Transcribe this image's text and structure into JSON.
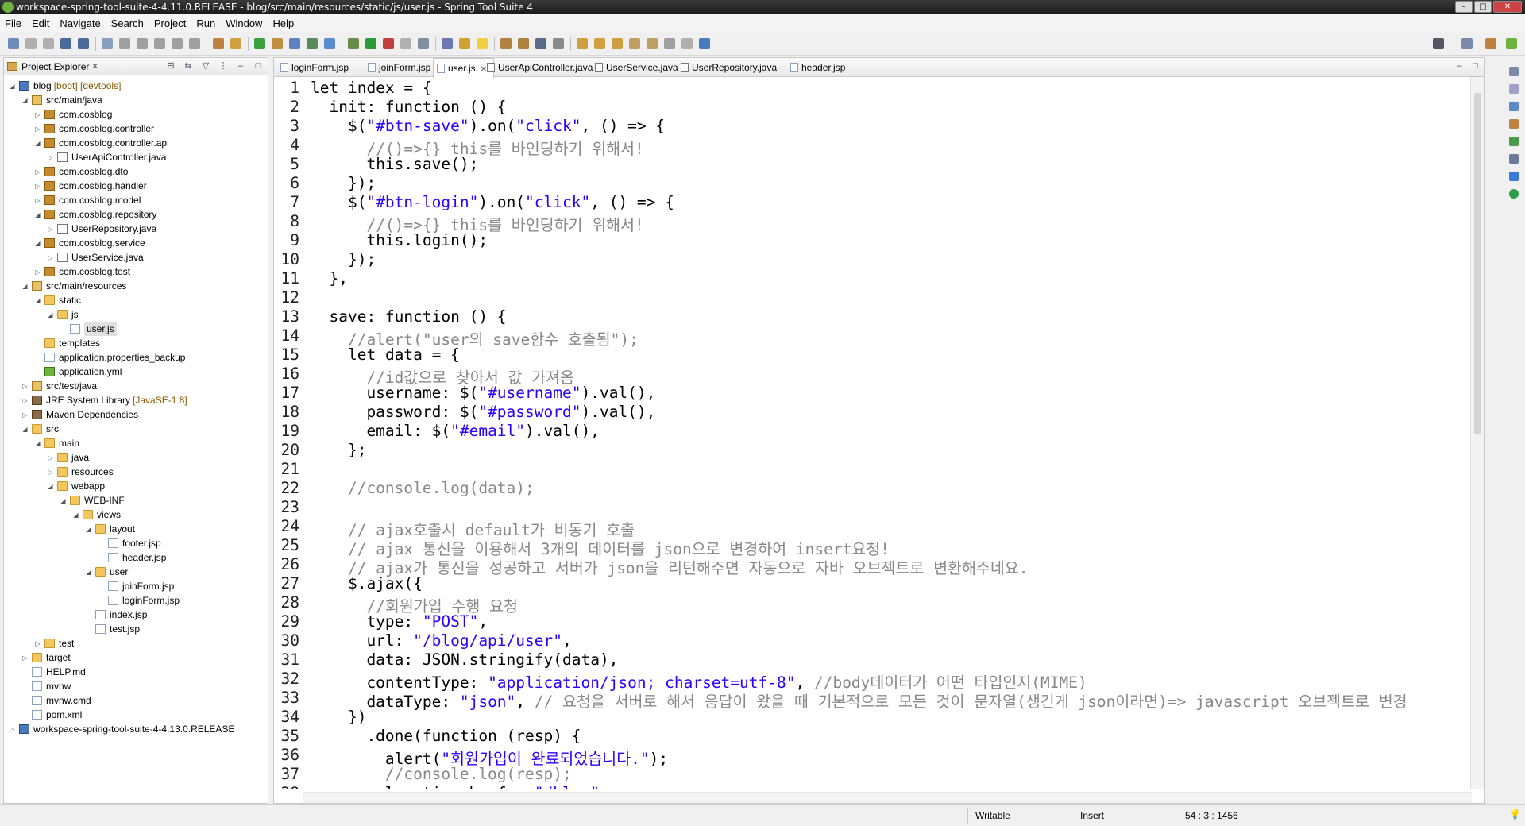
{
  "window": {
    "title": "workspace-spring-tool-suite-4-4.11.0.RELEASE - blog/src/main/resources/static/js/user.js - Spring Tool Suite 4"
  },
  "menu": [
    "File",
    "Edit",
    "Navigate",
    "Search",
    "Project",
    "Run",
    "Window",
    "Help"
  ],
  "explorer": {
    "title": "Project Explorer",
    "tree": [
      {
        "label": "blog",
        "extra": "[boot] [devtools]",
        "icon": "project",
        "depth": 0,
        "tw": "open"
      },
      {
        "label": "src/main/java",
        "icon": "source-folder",
        "depth": 1,
        "tw": "open"
      },
      {
        "label": "com.cosblog",
        "icon": "package",
        "depth": 2,
        "tw": "closed"
      },
      {
        "label": "com.cosblog.controller",
        "icon": "package",
        "depth": 2,
        "tw": "closed"
      },
      {
        "label": "com.cosblog.controller.api",
        "icon": "package",
        "depth": 2,
        "tw": "open"
      },
      {
        "label": "UserApiController.java",
        "icon": "java",
        "depth": 3,
        "tw": "closed"
      },
      {
        "label": "com.cosblog.dto",
        "icon": "package",
        "depth": 2,
        "tw": "closed"
      },
      {
        "label": "com.cosblog.handler",
        "icon": "package",
        "depth": 2,
        "tw": "closed"
      },
      {
        "label": "com.cosblog.model",
        "icon": "package",
        "depth": 2,
        "tw": "closed"
      },
      {
        "label": "com.cosblog.repository",
        "icon": "package",
        "depth": 2,
        "tw": "open"
      },
      {
        "label": "UserRepository.java",
        "icon": "java",
        "depth": 3,
        "tw": "closed"
      },
      {
        "label": "com.cosblog.service",
        "icon": "package",
        "depth": 2,
        "tw": "open"
      },
      {
        "label": "UserService.java",
        "icon": "java",
        "depth": 3,
        "tw": "closed"
      },
      {
        "label": "com.cosblog.test",
        "icon": "package",
        "depth": 2,
        "tw": "closed"
      },
      {
        "label": "src/main/resources",
        "icon": "source-folder",
        "depth": 1,
        "tw": "open"
      },
      {
        "label": "static",
        "icon": "folder",
        "depth": 2,
        "tw": "open"
      },
      {
        "label": "js",
        "icon": "folder",
        "depth": 3,
        "tw": "open"
      },
      {
        "label": "user.js",
        "icon": "file",
        "depth": 4,
        "tw": "none",
        "selected": true
      },
      {
        "label": "templates",
        "icon": "folder",
        "depth": 2,
        "tw": "none"
      },
      {
        "label": "application.properties_backup",
        "icon": "file",
        "depth": 2,
        "tw": "none"
      },
      {
        "label": "application.yml",
        "icon": "yml",
        "depth": 2,
        "tw": "none"
      },
      {
        "label": "src/test/java",
        "icon": "source-folder",
        "depth": 1,
        "tw": "closed"
      },
      {
        "label": "JRE System Library",
        "extra": "[JavaSE-1.8]",
        "icon": "library",
        "depth": 1,
        "tw": "closed"
      },
      {
        "label": "Maven Dependencies",
        "icon": "library",
        "depth": 1,
        "tw": "closed"
      },
      {
        "label": "src",
        "icon": "folder",
        "depth": 1,
        "tw": "open"
      },
      {
        "label": "main",
        "icon": "folder",
        "depth": 2,
        "tw": "open"
      },
      {
        "label": "java",
        "icon": "folder",
        "depth": 3,
        "tw": "closed"
      },
      {
        "label": "resources",
        "icon": "folder",
        "depth": 3,
        "tw": "closed"
      },
      {
        "label": "webapp",
        "icon": "folder",
        "depth": 3,
        "tw": "open"
      },
      {
        "label": "WEB-INF",
        "icon": "folder",
        "depth": 4,
        "tw": "open"
      },
      {
        "label": "views",
        "icon": "folder",
        "depth": 5,
        "tw": "open"
      },
      {
        "label": "layout",
        "icon": "folder",
        "depth": 6,
        "tw": "open"
      },
      {
        "label": "footer.jsp",
        "icon": "file",
        "depth": 7,
        "tw": "none"
      },
      {
        "label": "header.jsp",
        "icon": "file",
        "depth": 7,
        "tw": "none"
      },
      {
        "label": "user",
        "icon": "folder",
        "depth": 6,
        "tw": "open"
      },
      {
        "label": "joinForm.jsp",
        "icon": "file",
        "depth": 7,
        "tw": "none"
      },
      {
        "label": "loginForm.jsp",
        "icon": "file",
        "depth": 7,
        "tw": "none"
      },
      {
        "label": "index.jsp",
        "icon": "file",
        "depth": 6,
        "tw": "none"
      },
      {
        "label": "test.jsp",
        "icon": "file",
        "depth": 6,
        "tw": "none"
      },
      {
        "label": "test",
        "icon": "folder",
        "depth": 2,
        "tw": "closed"
      },
      {
        "label": "target",
        "icon": "folder",
        "depth": 1,
        "tw": "closed"
      },
      {
        "label": "HELP.md",
        "icon": "file",
        "depth": 1,
        "tw": "none"
      },
      {
        "label": "mvnw",
        "icon": "file",
        "depth": 1,
        "tw": "none"
      },
      {
        "label": "mvnw.cmd",
        "icon": "file",
        "depth": 1,
        "tw": "none"
      },
      {
        "label": "pom.xml",
        "icon": "file",
        "depth": 1,
        "tw": "none"
      },
      {
        "label": "workspace-spring-tool-suite-4-4.13.0.RELEASE",
        "icon": "project",
        "depth": 0,
        "tw": "closed"
      }
    ]
  },
  "tabs": [
    {
      "label": "loginForm.jsp",
      "active": false
    },
    {
      "label": "joinForm.jsp",
      "active": false
    },
    {
      "label": "user.js",
      "active": true
    },
    {
      "label": "UserApiController.java",
      "active": false
    },
    {
      "label": "UserService.java",
      "active": false
    },
    {
      "label": "UserRepository.java",
      "active": false
    },
    {
      "label": "header.jsp",
      "active": false
    }
  ],
  "code": [
    "let index = {",
    "  init: function () {",
    "    $(\"#btn-save\").on(\"click\", () => {",
    "      //()=>{} this를 바인딩하기 위해서!",
    "      this.save();",
    "    });",
    "    $(\"#btn-login\").on(\"click\", () => {",
    "      //()=>{} this를 바인딩하기 위해서!",
    "      this.login();",
    "    });",
    "  },",
    "",
    "  save: function () {",
    "    //alert(\"user의 save함수 호출됨\");",
    "    let data = {",
    "      //id값으로 찾아서 값 가져옴",
    "      username: $(\"#username\").val(),",
    "      password: $(\"#password\").val(),",
    "      email: $(\"#email\").val(),",
    "    };",
    "",
    "    //console.log(data);",
    "",
    "    // ajax호출시 default가 비동기 호출",
    "    // ajax 통신을 이용해서 3개의 데이터를 json으로 변경하여 insert요청!",
    "    // ajax가 통신을 성공하고 서버가 json을 리턴해주면 자동으로 자바 오브젝트로 변환해주네요.",
    "    $.ajax({",
    "      //회원가입 수행 요청",
    "      type: \"POST\",",
    "      url: \"/blog/api/user\",",
    "      data: JSON.stringify(data),",
    "      contentType: \"application/json; charset=utf-8\", //body데이터가 어떤 타입인지(MIME)",
    "      dataType: \"json\", // 요청을 서버로 해서 응답이 왔을 때 기본적으로 모든 것이 문자열(생긴게 json이라면)=> javascript 오브젝트로 변경",
    "    })",
    "      .done(function (resp) {",
    "        alert(\"회원가입이 완료되었습니다.\");",
    "        //console.log(resp);",
    "        location.href = \"/blog\";"
  ],
  "status": {
    "writable": "Writable",
    "insert": "Insert",
    "position": "54 : 3 : 1456"
  }
}
